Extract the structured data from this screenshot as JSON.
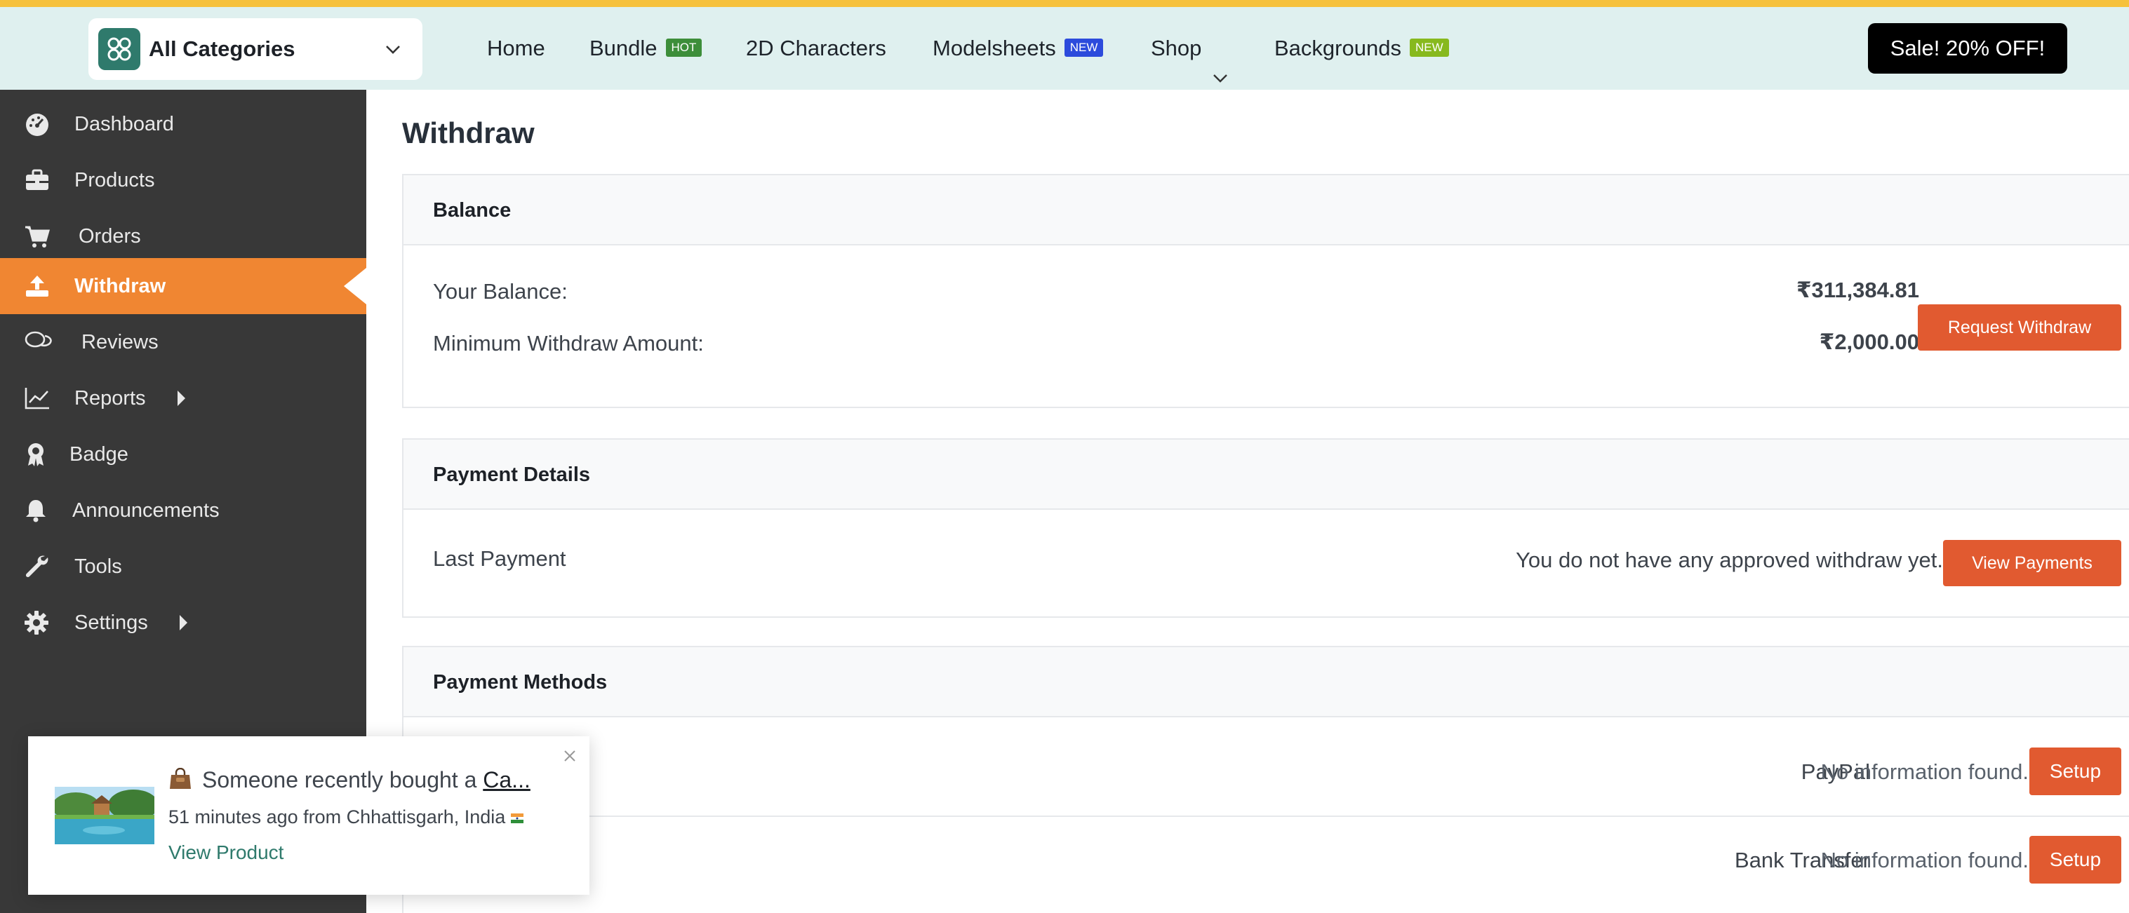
{
  "header": {
    "category_select": "All Categories",
    "nav": [
      {
        "label": "Home"
      },
      {
        "label": "Bundle",
        "badge": "HOT"
      },
      {
        "label": "2D Characters"
      },
      {
        "label": "Modelsheets",
        "badge": "NEW"
      },
      {
        "label": "Shop"
      },
      {
        "label": "Backgrounds",
        "badge": "NEW"
      }
    ],
    "sale_button": "Sale! 20% OFF!"
  },
  "sidebar": {
    "items": [
      {
        "label": "Dashboard",
        "icon": "gauge-icon"
      },
      {
        "label": "Products",
        "icon": "briefcase-icon"
      },
      {
        "label": "Orders",
        "icon": "cart-icon"
      },
      {
        "label": "Withdraw",
        "icon": "upload-icon",
        "active": true
      },
      {
        "label": "Reviews",
        "icon": "comments-icon"
      },
      {
        "label": "Reports",
        "icon": "line-chart-icon"
      },
      {
        "label": "Badge",
        "icon": "award-icon"
      },
      {
        "label": "Announcements",
        "icon": "bell-icon"
      },
      {
        "label": "Tools",
        "icon": "wrench-icon"
      },
      {
        "label": "Settings",
        "icon": "gear-icon"
      }
    ],
    "footer_icons": [
      "external-link-icon",
      "user-icon",
      "power-icon"
    ]
  },
  "main": {
    "title": "Withdraw",
    "balance": {
      "heading": "Balance",
      "your_balance_label": "Your Balance:",
      "your_balance_value": "₹311,384.81",
      "min_withdraw_label": "Minimum Withdraw Amount:",
      "min_withdraw_value": "₹2,000.00",
      "request_button": "Request Withdraw"
    },
    "payment_details": {
      "heading": "Payment Details",
      "last_payment_label": "Last Payment",
      "last_payment_value": "You do not have any approved withdraw yet.",
      "view_button": "View Payments"
    },
    "payment_methods": {
      "heading": "Payment Methods",
      "methods": [
        {
          "name": "PayPal",
          "info": "No information found.",
          "button": "Setup"
        },
        {
          "name": "Bank Transfer",
          "info": "No information found.",
          "button": "Setup"
        }
      ]
    }
  },
  "popup": {
    "message": "Someone recently bought a",
    "product_link": "Ca...",
    "time_location": "51 minutes ago from Chhattisgarh, India",
    "view_link": "View Product"
  },
  "colors": {
    "accent_orange": "#f08632",
    "button_red_orange": "#e15a30",
    "sidebar_bg": "#383838",
    "header_bg": "#dff0ef",
    "top_strip": "#f6c13c",
    "brand_green": "#2f7a6c"
  }
}
